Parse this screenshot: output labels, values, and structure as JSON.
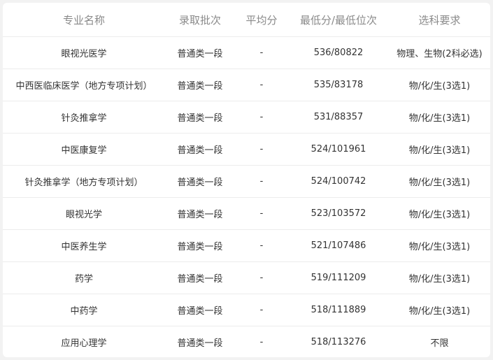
{
  "table": {
    "headers": [
      "专业名称",
      "录取批次",
      "平均分",
      "最低分/最低位次",
      "选科要求"
    ],
    "rows": [
      [
        "眼视光医学",
        "普通类一段",
        "-",
        "536/80822",
        "物理、生物(2科必选)"
      ],
      [
        "中西医临床医学（地方专项计划）",
        "普通类一段",
        "-",
        "535/83178",
        "物/化/生(3选1)"
      ],
      [
        "针灸推拿学",
        "普通类一段",
        "-",
        "531/88357",
        "物/化/生(3选1)"
      ],
      [
        "中医康复学",
        "普通类一段",
        "-",
        "524/101961",
        "物/化/生(3选1)"
      ],
      [
        "针灸推拿学（地方专项计划）",
        "普通类一段",
        "-",
        "524/100742",
        "物/化/生(3选1)"
      ],
      [
        "眼视光学",
        "普通类一段",
        "-",
        "523/103572",
        "物/化/生(3选1)"
      ],
      [
        "中医养生学",
        "普通类一段",
        "-",
        "521/107486",
        "物/化/生(3选1)"
      ],
      [
        "药学",
        "普通类一段",
        "-",
        "519/111209",
        "物/化/生(3选1)"
      ],
      [
        "中药学",
        "普通类一段",
        "-",
        "518/111889",
        "物/化/生(3选1)"
      ],
      [
        "应用心理学",
        "普通类一段",
        "-",
        "518/113276",
        "不限"
      ]
    ]
  }
}
